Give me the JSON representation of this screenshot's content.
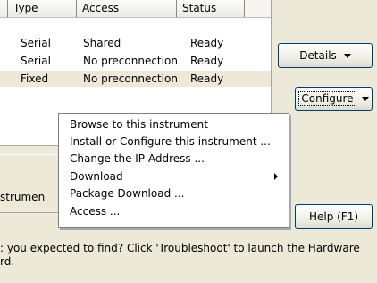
{
  "table": {
    "headers": {
      "type": "Type",
      "access": "Access",
      "status": "Status"
    },
    "rows": [
      {
        "type": "Serial",
        "access": "Shared",
        "status": "Ready"
      },
      {
        "type": "Serial",
        "access": "No preconnection",
        "status": "Ready"
      },
      {
        "type": "Fixed",
        "access": "No preconnection",
        "status": "Ready"
      }
    ]
  },
  "buttons": {
    "details": "Details",
    "configure": "Configure",
    "help": "Help (F1)"
  },
  "context_menu": {
    "items": [
      "Browse to this instrument",
      "Install or Configure this instrument ...",
      "Change the IP Address ...",
      "Download",
      "Package Download ...",
      "Access ..."
    ]
  },
  "status_panel": {
    "label": "strumen"
  },
  "footer": {
    "text": ": you expected to find?  Click 'Troubleshoot' to launch the Hardware\nrd."
  },
  "colors": {
    "window_background": "#ece9d8",
    "list_background": "#ffffff",
    "selected_row": "#ece9d8",
    "button_border": "#003c74"
  }
}
